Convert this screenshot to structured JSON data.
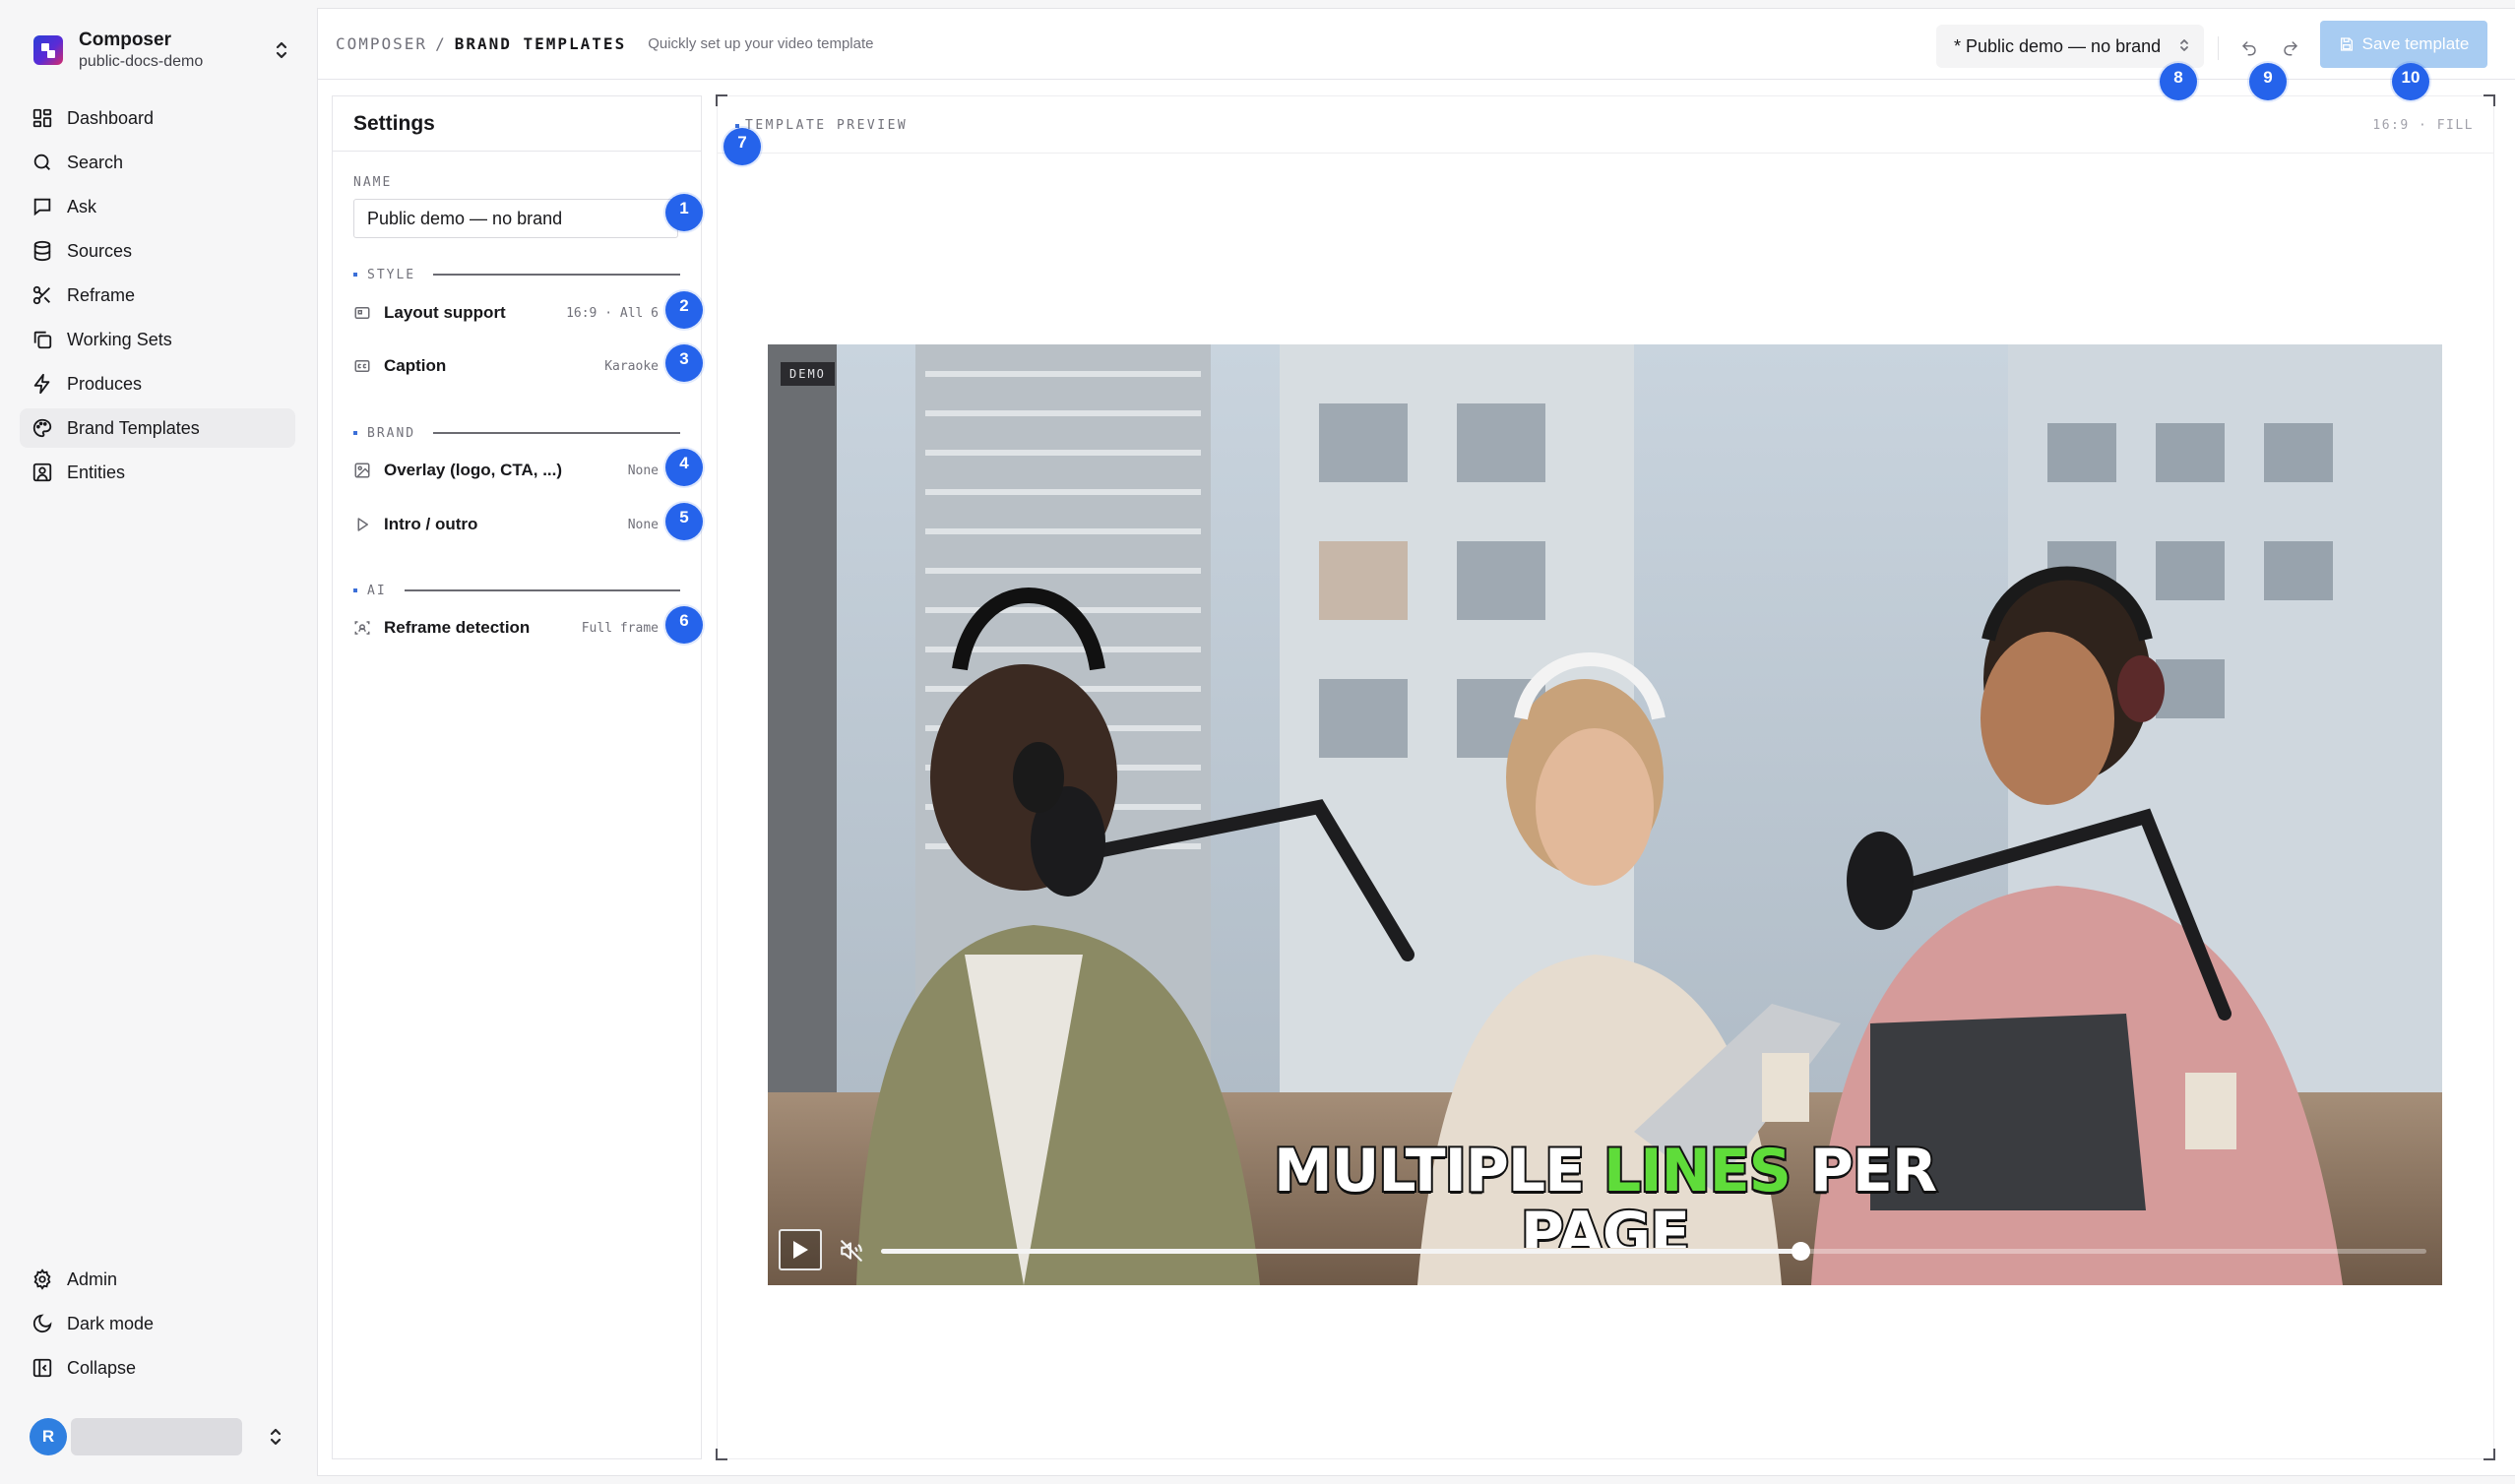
{
  "org": {
    "name": "Composer",
    "workspace": "public-docs-demo"
  },
  "nav": {
    "items": [
      {
        "label": "Dashboard",
        "icon": "dashboard-icon"
      },
      {
        "label": "Search",
        "icon": "search-icon"
      },
      {
        "label": "Ask",
        "icon": "chat-icon"
      },
      {
        "label": "Sources",
        "icon": "database-icon"
      },
      {
        "label": "Reframe",
        "icon": "scissors-icon"
      },
      {
        "label": "Working Sets",
        "icon": "copy-icon"
      },
      {
        "label": "Produces",
        "icon": "lightning-icon"
      },
      {
        "label": "Brand Templates",
        "icon": "palette-icon",
        "active": true
      },
      {
        "label": "Entities",
        "icon": "user-square-icon"
      }
    ],
    "bottom": [
      {
        "label": "Admin",
        "icon": "gear-icon"
      },
      {
        "label": "Dark mode",
        "icon": "moon-icon"
      },
      {
        "label": "Collapse",
        "icon": "sidebar-collapse-icon"
      }
    ]
  },
  "user": {
    "initial": "R"
  },
  "header": {
    "crumb_root": "COMPOSER",
    "crumb_sep": "/",
    "crumb_current": "BRAND TEMPLATES",
    "subtitle": "Quickly set up your video template",
    "template_select": "* Public demo — no brand",
    "save_label": "Save template"
  },
  "settings": {
    "title": "Settings",
    "name_label": "NAME",
    "name_value": "Public demo — no brand",
    "sections": {
      "style": "STYLE",
      "brand": "BRAND",
      "ai": "AI"
    },
    "rows": {
      "layout": {
        "label": "Layout support",
        "value": "16:9 · All 6"
      },
      "caption": {
        "label": "Caption",
        "value": "Karaoke"
      },
      "overlay": {
        "label": "Overlay (logo, CTA, ...)",
        "value": "None"
      },
      "intro": {
        "label": "Intro / outro",
        "value": "None"
      },
      "reframe": {
        "label": "Reframe detection",
        "value": "Full frame"
      }
    }
  },
  "preview": {
    "title": "TEMPLATE PREVIEW",
    "meta": "16:9 · FILL",
    "demo_tag": "DEMO",
    "caption_line1_a": "MULTIPLE",
    "caption_line1_hl": "LINES",
    "caption_line1_b": "PER",
    "caption_line2": "PAGE",
    "progress": 0.595
  },
  "badges": [
    "1",
    "2",
    "3",
    "4",
    "5",
    "6",
    "7",
    "8",
    "9",
    "10"
  ],
  "colors": {
    "accent": "#2563eb",
    "save_disabled": "#a8ccf2",
    "caption_highlight": "#5fdc3a"
  }
}
